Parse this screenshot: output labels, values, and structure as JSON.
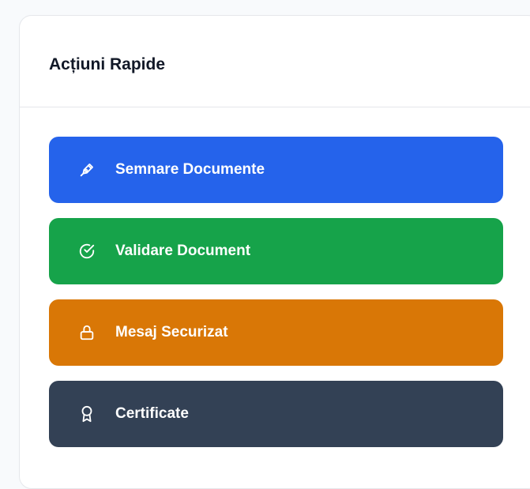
{
  "card": {
    "title": "Acțiuni Rapide"
  },
  "actions": [
    {
      "label": "Semnare Documente",
      "icon": "pen-tool-icon",
      "color": "#2563eb"
    },
    {
      "label": "Validare Document",
      "icon": "check-circle-icon",
      "color": "#16a34a"
    },
    {
      "label": "Mesaj Securizat",
      "icon": "lock-icon",
      "color": "#d97706"
    },
    {
      "label": "Certificate",
      "icon": "award-icon",
      "color": "#334155"
    }
  ]
}
